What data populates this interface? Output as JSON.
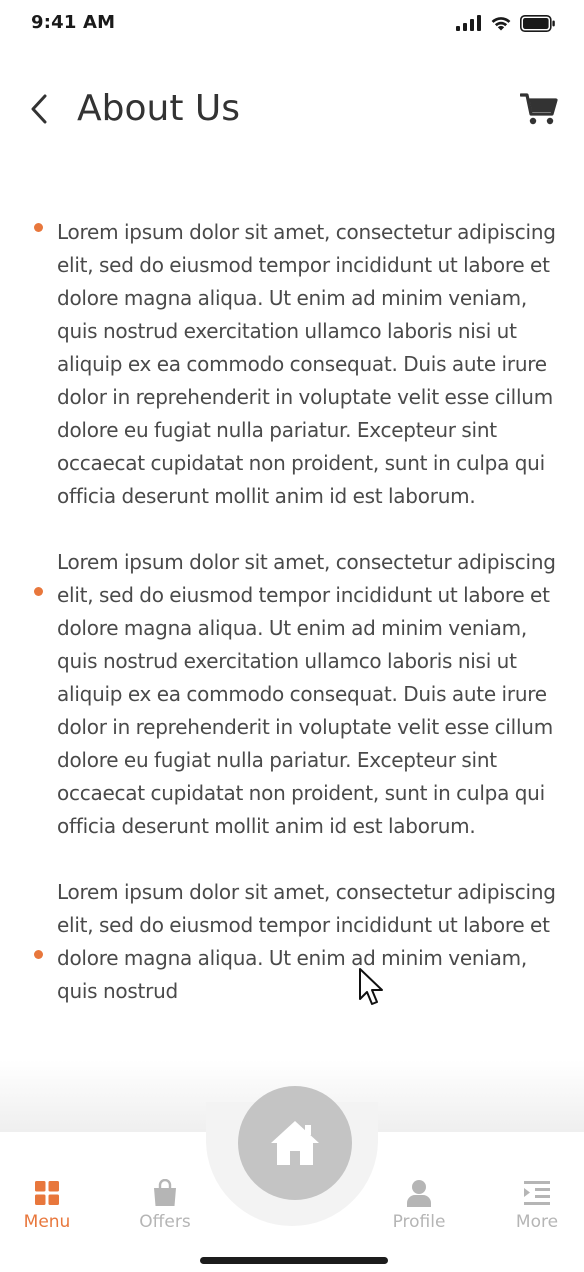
{
  "status_bar": {
    "time": "9:41 AM"
  },
  "header": {
    "title": "About Us"
  },
  "paragraphs": [
    "Lorem ipsum dolor sit amet, consectetur adipiscing elit, sed do eiusmod tempor incididunt ut labore et dolore magna aliqua. Ut enim ad minim veniam, quis nostrud exercitation ullamco laboris nisi ut aliquip ex ea commodo consequat. Duis aute irure dolor in reprehenderit in voluptate velit esse cillum dolore eu fugiat nulla pariatur. Excepteur sint occaecat cupidatat non proident, sunt in culpa qui officia deserunt mollit anim id est laborum.",
    "Lorem ipsum dolor sit amet, consectetur adipiscing elit, sed do eiusmod tempor incididunt ut labore et dolore magna aliqua. Ut enim ad minim veniam, quis nostrud exercitation ullamco laboris nisi ut aliquip ex ea commodo consequat. Duis aute irure dolor in reprehenderit in voluptate velit esse cillum dolore eu fugiat nulla pariatur. Excepteur sint occaecat cupidatat non proident, sunt in culpa qui officia deserunt mollit anim id est laborum.",
    "Lorem ipsum dolor sit amet, consectetur adipiscing elit, sed do eiusmod tempor incididunt ut labore et dolore magna aliqua. Ut enim ad minim veniam, quis nostrud"
  ],
  "bottom_nav": {
    "items": [
      {
        "label": "Menu",
        "icon": "grid-icon",
        "active": true
      },
      {
        "label": "Offers",
        "icon": "shopping-bag-icon",
        "active": false
      },
      {
        "label": "Profile",
        "icon": "person-icon",
        "active": false
      },
      {
        "label": "More",
        "icon": "more-list-icon",
        "active": false
      }
    ],
    "center_button_icon": "home-icon"
  },
  "colors": {
    "accent": "#e8773c",
    "text": "#4a4a4a",
    "title": "#333333",
    "nav_inactive": "#b5b5b5",
    "fab": "#c4c4c4"
  }
}
